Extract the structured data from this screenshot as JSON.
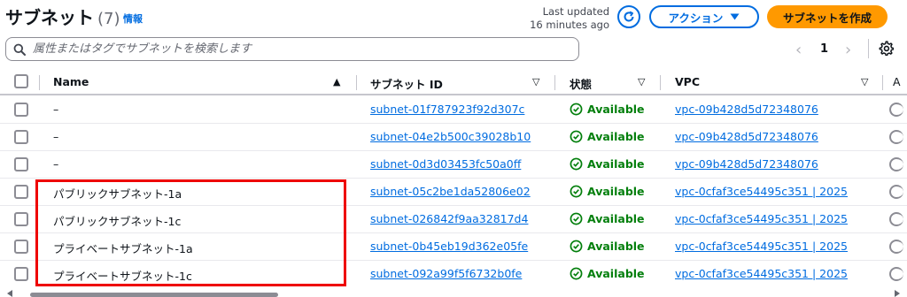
{
  "header": {
    "title": "サブネット",
    "count": "(7)",
    "info_link": "情報",
    "last_updated_line1": "Last updated",
    "last_updated_line2": "16 minutes ago",
    "action_button": "アクション",
    "create_button": "サブネットを作成"
  },
  "search": {
    "placeholder": "属性またはタグでサブネットを検索します"
  },
  "pagination": {
    "current_page": "1"
  },
  "table": {
    "columns": [
      "Name",
      "サブネット ID",
      "状態",
      "VPC"
    ],
    "rows": [
      {
        "name": "–",
        "subnet_id": "subnet-01f787923f92d307c",
        "state": "Available",
        "vpc": "vpc-09b428d5d72348076"
      },
      {
        "name": "–",
        "subnet_id": "subnet-04e2b500c39028b10",
        "state": "Available",
        "vpc": "vpc-09b428d5d72348076"
      },
      {
        "name": "–",
        "subnet_id": "subnet-0d3d03453fc50a0ff",
        "state": "Available",
        "vpc": "vpc-09b428d5d72348076"
      },
      {
        "name": "パブリックサブネット-1a",
        "subnet_id": "subnet-05c2be1da52806e02",
        "state": "Available",
        "vpc": "vpc-0cfaf3ce54495c351 | 2025"
      },
      {
        "name": "パブリックサブネット-1c",
        "subnet_id": "subnet-026842f9aa32817d4",
        "state": "Available",
        "vpc": "vpc-0cfaf3ce54495c351 | 2025"
      },
      {
        "name": "プライベートサブネット-1a",
        "subnet_id": "subnet-0b45eb19d362e05fe",
        "state": "Available",
        "vpc": "vpc-0cfaf3ce54495c351 | 2025"
      },
      {
        "name": "プライベートサブネット-1c",
        "subnet_id": "subnet-092a99f5f6732b0fe",
        "state": "Available",
        "vpc": "vpc-0cfaf3ce54495c351 | 2025"
      }
    ]
  },
  "colors": {
    "link": "#006ce0",
    "primary_button": "#ff9900",
    "available": "#037f0c",
    "highlight_box": "#ee0000"
  },
  "icons": {
    "search": "search-icon",
    "refresh": "refresh-icon",
    "caret": "caret-down-icon",
    "settings": "gear-icon",
    "status": "check-circle-icon"
  }
}
